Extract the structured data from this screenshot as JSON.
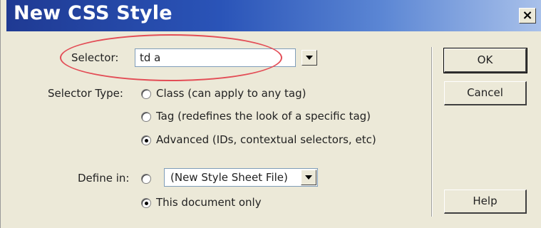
{
  "window": {
    "title": "New CSS Style",
    "close_label": "×"
  },
  "selector": {
    "label": "Selector:",
    "value": "td a"
  },
  "selector_type": {
    "label": "Selector Type:",
    "options": [
      {
        "label": "Class (can apply to any tag)",
        "checked": false
      },
      {
        "label": "Tag (redefines the look of a specific tag)",
        "checked": false
      },
      {
        "label": "Advanced (IDs, contextual selectors, etc)",
        "checked": true
      }
    ]
  },
  "define_in": {
    "label": "Define in:",
    "options": [
      {
        "label": "(New Style Sheet File)",
        "checked": false
      },
      {
        "label": "This document only",
        "checked": true
      }
    ]
  },
  "buttons": {
    "ok": "OK",
    "cancel": "Cancel",
    "help": "Help"
  },
  "colors": {
    "highlight_ellipse": "#e34d56",
    "titlebar_start": "#1f3a93",
    "titlebar_end": "#a9c1ea",
    "dialog_bg": "#ece9d8"
  }
}
